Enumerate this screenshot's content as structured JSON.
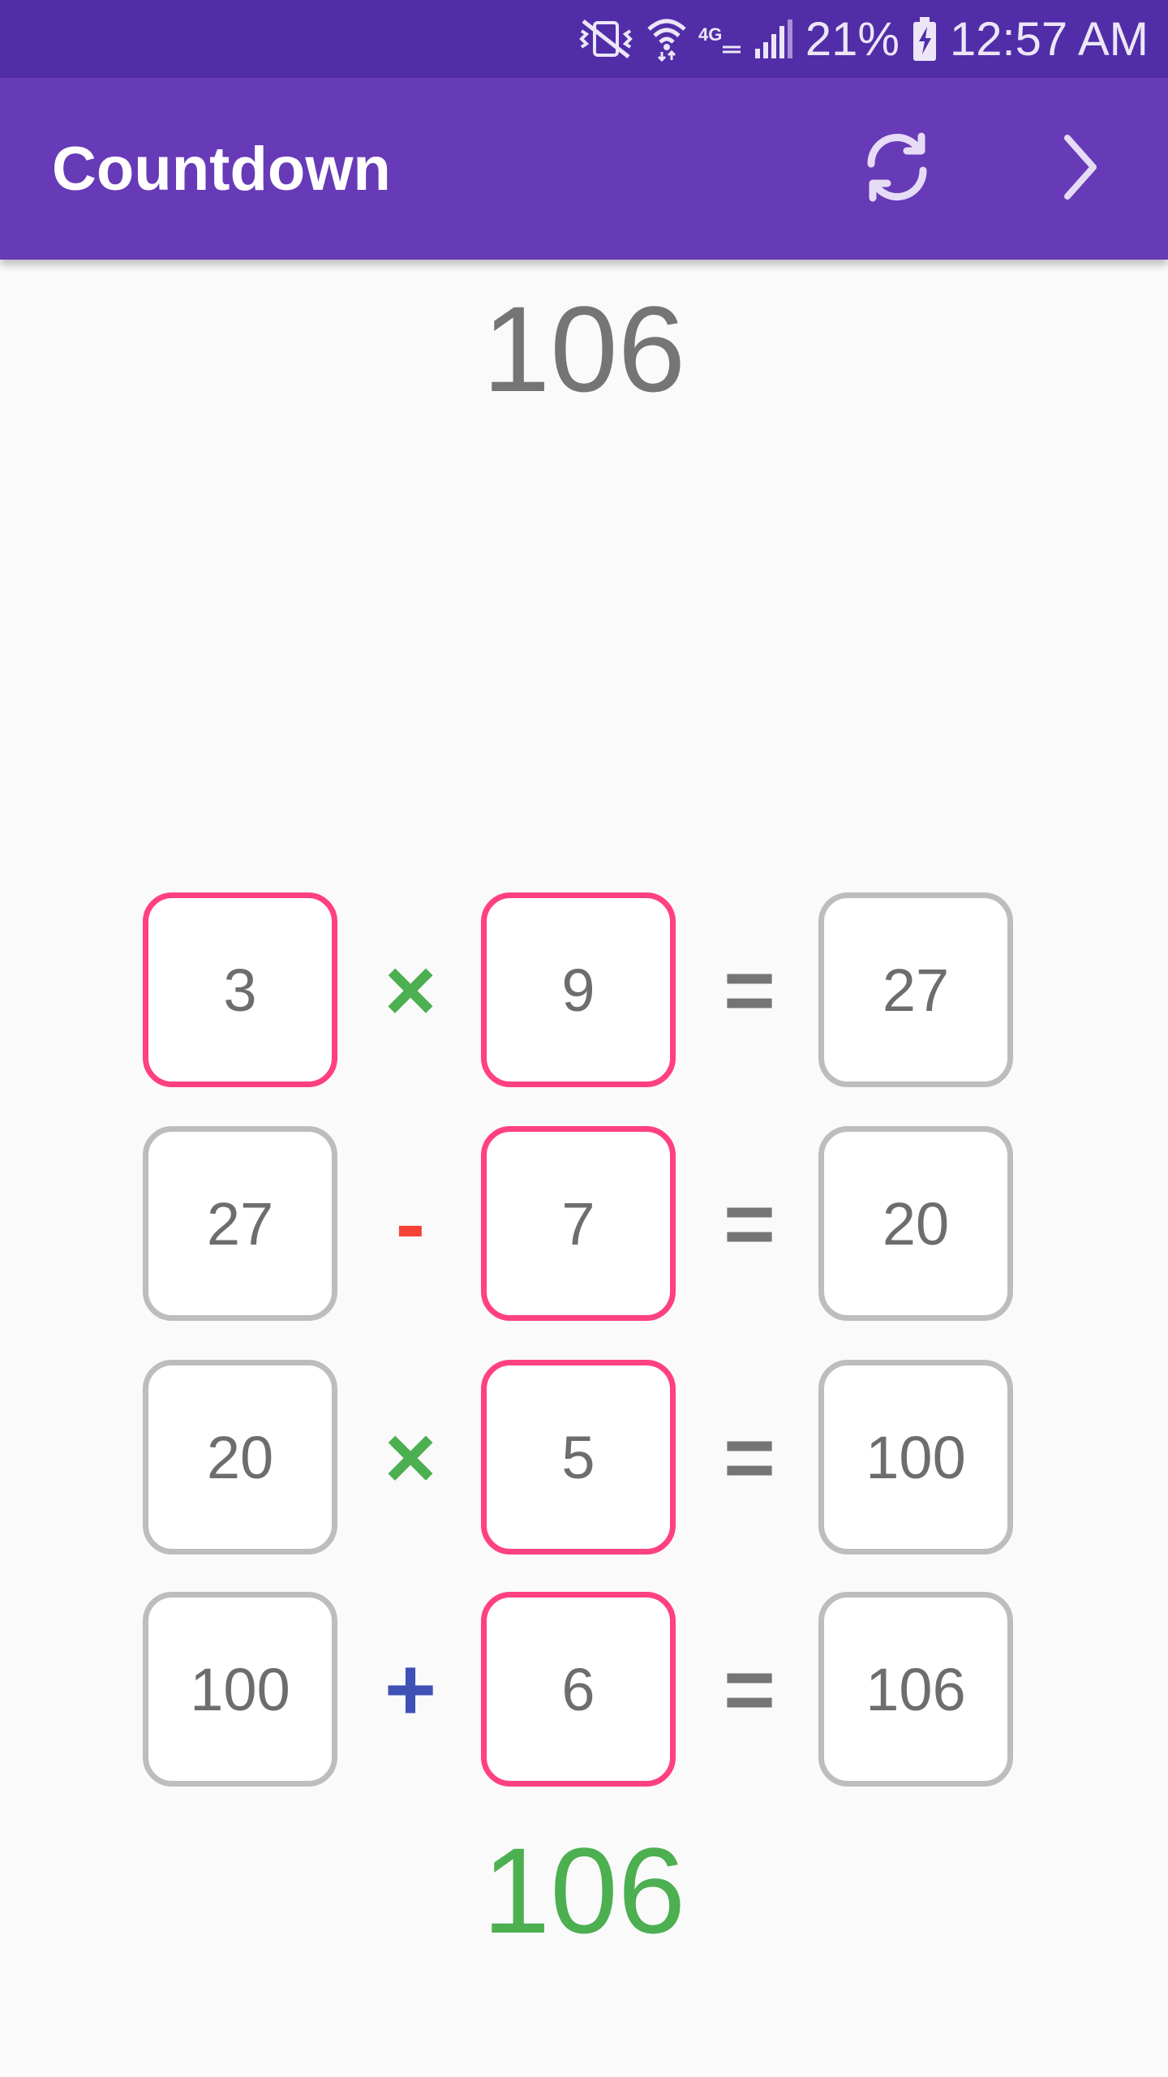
{
  "status_bar": {
    "battery": "21%",
    "time": "12:57 AM",
    "icons": [
      "mute-vibrate-icon",
      "wifi-icon",
      "4g-lte-icon",
      "signal-icon",
      "battery-charging-icon"
    ]
  },
  "app_bar": {
    "title": "Countdown",
    "actions": [
      "refresh-icon",
      "chevron-right-icon"
    ]
  },
  "target": "106",
  "equations": [
    {
      "a": "3",
      "a_selected": true,
      "op": "×",
      "op_color": "#4caf50",
      "b": "9",
      "b_selected": true,
      "result": "27"
    },
    {
      "a": "27",
      "a_selected": false,
      "op": "-",
      "op_color": "#f44336",
      "b": "7",
      "b_selected": true,
      "result": "20"
    },
    {
      "a": "20",
      "a_selected": false,
      "op": "×",
      "op_color": "#4caf50",
      "b": "5",
      "b_selected": true,
      "result": "100"
    },
    {
      "a": "100",
      "a_selected": false,
      "op": "+",
      "op_color": "#3f51b5",
      "b": "6",
      "b_selected": true,
      "result": "106"
    }
  ],
  "equals": "=",
  "final_result": "106",
  "colors": {
    "primary": "#673ab7",
    "primary_dark": "#512da8",
    "accent_pink": "#ff4081",
    "tile_gray": "#bdbdbd",
    "success_green": "#4caf50"
  }
}
